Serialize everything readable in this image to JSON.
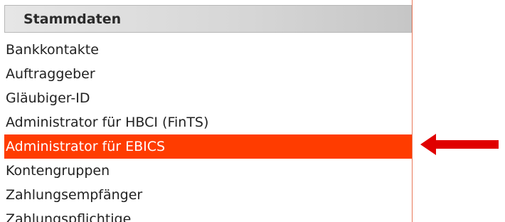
{
  "panel": {
    "title": "Stammdaten",
    "items": [
      {
        "label": "Bankkontakte",
        "selected": false
      },
      {
        "label": "Auftraggeber",
        "selected": false
      },
      {
        "label": "Gläubiger-ID",
        "selected": false
      },
      {
        "label": "Administrator für HBCI (FinTS)",
        "selected": false
      },
      {
        "label": "Administrator für EBICS",
        "selected": true
      },
      {
        "label": "Kontengruppen",
        "selected": false
      },
      {
        "label": "Zahlungsempfänger",
        "selected": false
      },
      {
        "label": "Zahlungspflichtige",
        "selected": false
      }
    ]
  },
  "annotation": {
    "icon": "left-arrow-icon",
    "color": "#e00000"
  },
  "colors": {
    "selected_background": "#ff3c00",
    "selected_text": "#ffffff",
    "panel_border": "#e8785a"
  }
}
